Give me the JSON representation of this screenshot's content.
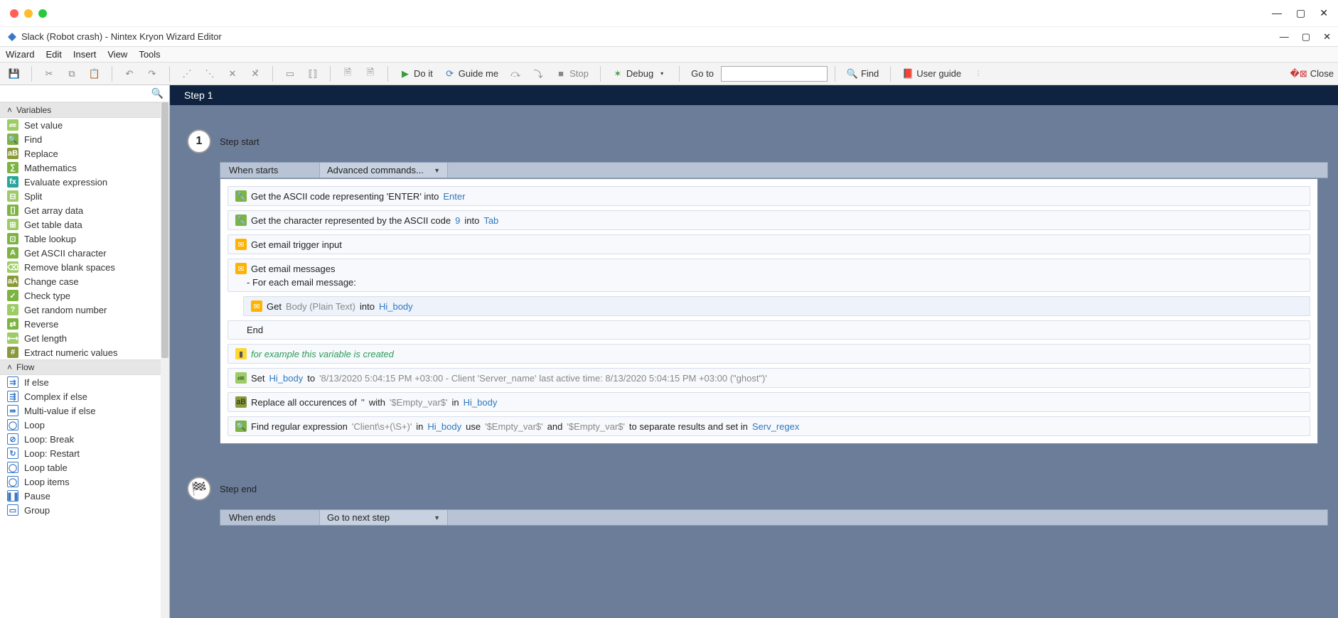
{
  "macControls": {
    "min": "—",
    "max": "▢",
    "close": "✕"
  },
  "title": "Slack (Robot crash) - Nintex Kryon Wizard Editor",
  "menu": [
    "Wizard",
    "Edit",
    "Insert",
    "View",
    "Tools"
  ],
  "toolbar": {
    "doit": "Do it",
    "guideme": "Guide me",
    "stop": "Stop",
    "debug": "Debug",
    "goto": "Go to",
    "find": "Find",
    "userguide": "User guide",
    "close": "Close",
    "goto_value": ""
  },
  "sidebar": {
    "groups": [
      {
        "name": "Variables",
        "items": [
          {
            "icon": "≔",
            "bg": "bg-lime",
            "label": "Set value"
          },
          {
            "icon": "🔍",
            "bg": "bg-green",
            "label": "Find"
          },
          {
            "icon": "aB",
            "bg": "bg-olive",
            "label": "Replace"
          },
          {
            "icon": "∑",
            "bg": "bg-green",
            "label": "Mathematics"
          },
          {
            "icon": "fx",
            "bg": "bg-teal",
            "label": "Evaluate expression"
          },
          {
            "icon": "⊟",
            "bg": "bg-lime",
            "label": "Split"
          },
          {
            "icon": "[]",
            "bg": "bg-green",
            "label": "Get array data"
          },
          {
            "icon": "⊞",
            "bg": "bg-lime",
            "label": "Get table data"
          },
          {
            "icon": "⊡",
            "bg": "bg-green",
            "label": "Table lookup"
          },
          {
            "icon": "A",
            "bg": "bg-green",
            "label": "Get ASCII character"
          },
          {
            "icon": "⌫",
            "bg": "bg-lime",
            "label": "Remove blank spaces"
          },
          {
            "icon": "aA",
            "bg": "bg-olive",
            "label": "Change case"
          },
          {
            "icon": "✓",
            "bg": "bg-green",
            "label": "Check type"
          },
          {
            "icon": "?",
            "bg": "bg-lime",
            "label": "Get random number"
          },
          {
            "icon": "⇄",
            "bg": "bg-green",
            "label": "Reverse"
          },
          {
            "icon": "⟷",
            "bg": "bg-lime",
            "label": "Get length"
          },
          {
            "icon": "#",
            "bg": "bg-olive",
            "label": "Extract numeric values"
          }
        ]
      },
      {
        "name": "Flow",
        "items": [
          {
            "icon": "⇉",
            "bg": "bg-white-border txt-blue",
            "label": "If else"
          },
          {
            "icon": "⇶",
            "bg": "bg-white-border txt-blue",
            "label": "Complex if else"
          },
          {
            "icon": "⇛",
            "bg": "bg-white-border txt-blue",
            "label": "Multi-value if else"
          },
          {
            "icon": "◯",
            "bg": "bg-white-border txt-blue",
            "label": "Loop"
          },
          {
            "icon": "⊘",
            "bg": "bg-white-border txt-blue",
            "label": "  Loop: Break"
          },
          {
            "icon": "↻",
            "bg": "bg-white-border txt-blue",
            "label": "  Loop: Restart"
          },
          {
            "icon": "◯",
            "bg": "bg-white-border txt-blue",
            "label": "Loop table"
          },
          {
            "icon": "◯",
            "bg": "bg-white-border txt-blue",
            "label": "Loop items"
          },
          {
            "icon": "❚❚",
            "bg": "bg-white-border txt-blue",
            "label": "Pause"
          },
          {
            "icon": "▭",
            "bg": "bg-white-border txt-blue",
            "label": "Group"
          }
        ]
      }
    ]
  },
  "canvas": {
    "stepTab": "Step 1",
    "step1": {
      "num": "1",
      "title": "Step start",
      "strip_label": "When starts",
      "strip_drop": "Advanced commands..."
    },
    "actions": {
      "a1_pre": "Get the ASCII code representing 'ENTER' into",
      "a1_var": "Enter",
      "a2_pre": "Get the character represented by the ASCII code",
      "a2_num": "9",
      "a2_mid": "into",
      "a2_var": "Tab",
      "a3": "Get email trigger input",
      "a4": "Get email messages",
      "a4_sub": "-   For each email message:",
      "a5_pre": "Get",
      "a5_grey": "Body (Plain Text)",
      "a5_mid": "into",
      "a5_var": "Hi_body",
      "a6": "End",
      "a7": "for example this variable is created",
      "a8_pre": "Set",
      "a8_var": "Hi_body",
      "a8_mid": "to",
      "a8_val": "'8/13/2020 5:04:15 PM +03:00 - Client 'Server_name' last active time: 8/13/2020 5:04:15 PM +03:00 (\"ghost\")'",
      "a9_pre": "Replace all occurences of",
      "a9_q1": "''",
      "a9_mid1": "with",
      "a9_q2": "'$Empty_var$'",
      "a9_mid2": "in",
      "a9_var": "Hi_body",
      "a10_pre": "Find regular expression",
      "a10_rx": "'Client\\s+(\\S+)'",
      "a10_mid1": "in",
      "a10_var1": "Hi_body",
      "a10_mid2": "use",
      "a10_q1": "'$Empty_var$'",
      "a10_mid3": "and",
      "a10_q2": "'$Empty_var$'",
      "a10_mid4": "to separate results and set in",
      "a10_var2": "Serv_regex"
    },
    "stepEnd": {
      "title": "Step end",
      "strip_label": "When ends",
      "strip_drop": "Go to next step"
    }
  }
}
